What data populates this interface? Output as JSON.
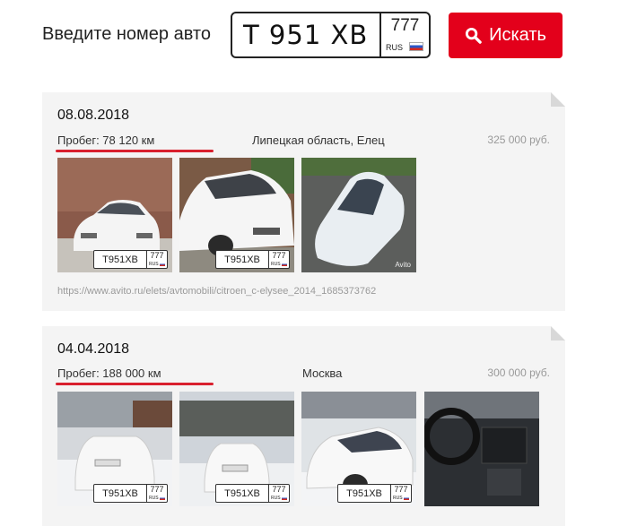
{
  "search": {
    "label": "Введите номер авто",
    "plate_main": "Т 951 ХВ",
    "plate_region": "777",
    "plate_country": "RUS",
    "button_label": "Искать",
    "button_color": "#e3001b"
  },
  "listings": [
    {
      "date": "08.08.2018",
      "mileage": "Пробег: 78 120 км",
      "city": "Липецкая область, Елец",
      "price": "325 000 руб.",
      "url": "https://www.avito.ru/elets/avtomobili/citroen_c-elysee_2014_1685373762",
      "photos": [
        {
          "plate": "Т951ХВ",
          "region": "777",
          "country": "RUS"
        },
        {
          "plate": "Т951ХВ",
          "region": "777",
          "country": "RUS"
        },
        {
          "watermark": "Avito"
        }
      ]
    },
    {
      "date": "04.04.2018",
      "mileage": "Пробег: 188 000 км",
      "city": "Москва",
      "price": "300 000 руб.",
      "photos": [
        {
          "plate": "Т951ХВ",
          "region": "777",
          "country": "RUS"
        },
        {
          "plate": "Т951ХВ",
          "region": "777",
          "country": "RUS"
        },
        {
          "plate": "Т951ХВ",
          "region": "777",
          "country": "RUS"
        },
        {}
      ]
    }
  ],
  "colors": {
    "accent_red": "#d9202e",
    "card_bg": "#f4f4f4"
  }
}
